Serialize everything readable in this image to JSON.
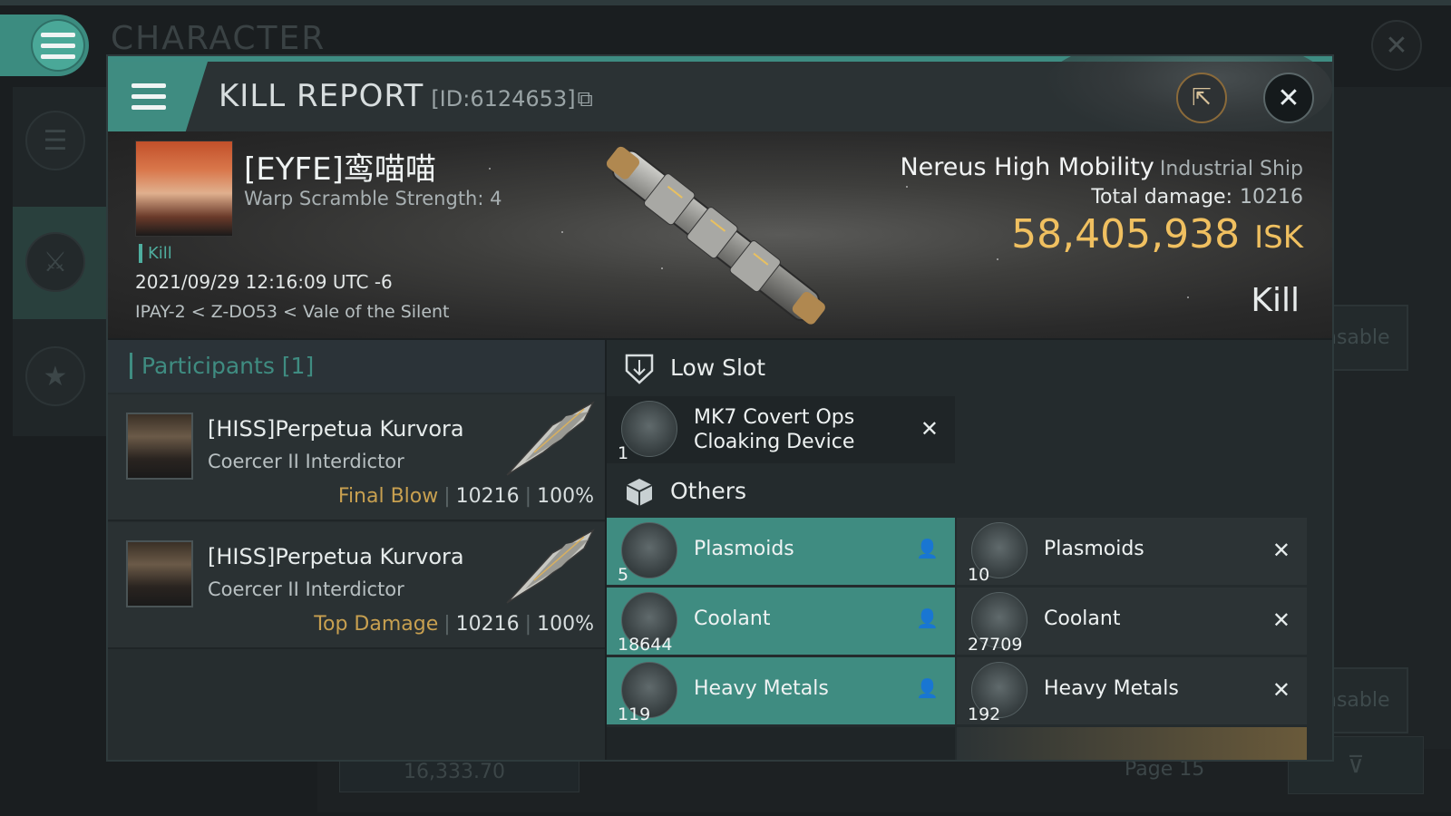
{
  "background": {
    "title": "CHARACTER",
    "right_button_1": "nsable",
    "right_button_2": "nsable",
    "wallet_amount": "16,333.70",
    "page_label": "Page 15"
  },
  "header": {
    "title": "KILL REPORT",
    "id_label": "[ID:6124653]"
  },
  "victim": {
    "name": "[EYFE]鸾喵喵",
    "warp_scramble": "Warp Scramble Strength: 4",
    "tag": "Kill",
    "timestamp": "2021/09/29 12:16:09 UTC -6",
    "location": "IPAY-2 < Z-DO53 < Vale of the Silent",
    "ship_name": "Nereus High Mobility",
    "ship_class": "Industrial Ship",
    "total_damage_label": "Total damage:",
    "total_damage": "10216",
    "isk_value": "58,405,938",
    "isk_unit": "ISK",
    "result": "Kill"
  },
  "participants": {
    "title": "Participants [1]",
    "rows": [
      {
        "name": "[HISS]Perpetua Kurvora",
        "ship": "Coercer II Interdictor",
        "tag": "Final Blow",
        "damage": "10216",
        "percent": "100%"
      },
      {
        "name": "[HISS]Perpetua Kurvora",
        "ship": "Coercer II Interdictor",
        "tag": "Top Damage",
        "damage": "10216",
        "percent": "100%"
      }
    ]
  },
  "fitting": {
    "low_slot_title": "Low Slot",
    "low_slot_items": [
      {
        "name_line1": "MK7 Covert Ops",
        "name_line2": "Cloaking Device",
        "qty": "1"
      }
    ],
    "others_title": "Others",
    "others_dropped": [
      {
        "name": "Plasmoids",
        "qty": "5"
      },
      {
        "name": "Coolant",
        "qty": "18644"
      },
      {
        "name": "Heavy Metals",
        "qty": "119"
      }
    ],
    "others_destroyed": [
      {
        "name": "Plasmoids",
        "qty": "10"
      },
      {
        "name": "Coolant",
        "qty": "27709"
      },
      {
        "name": "Heavy Metals",
        "qty": "192"
      }
    ]
  },
  "colors": {
    "accent": "#3f8c81",
    "isk": "#f0c060",
    "tag": "#c8a050"
  }
}
